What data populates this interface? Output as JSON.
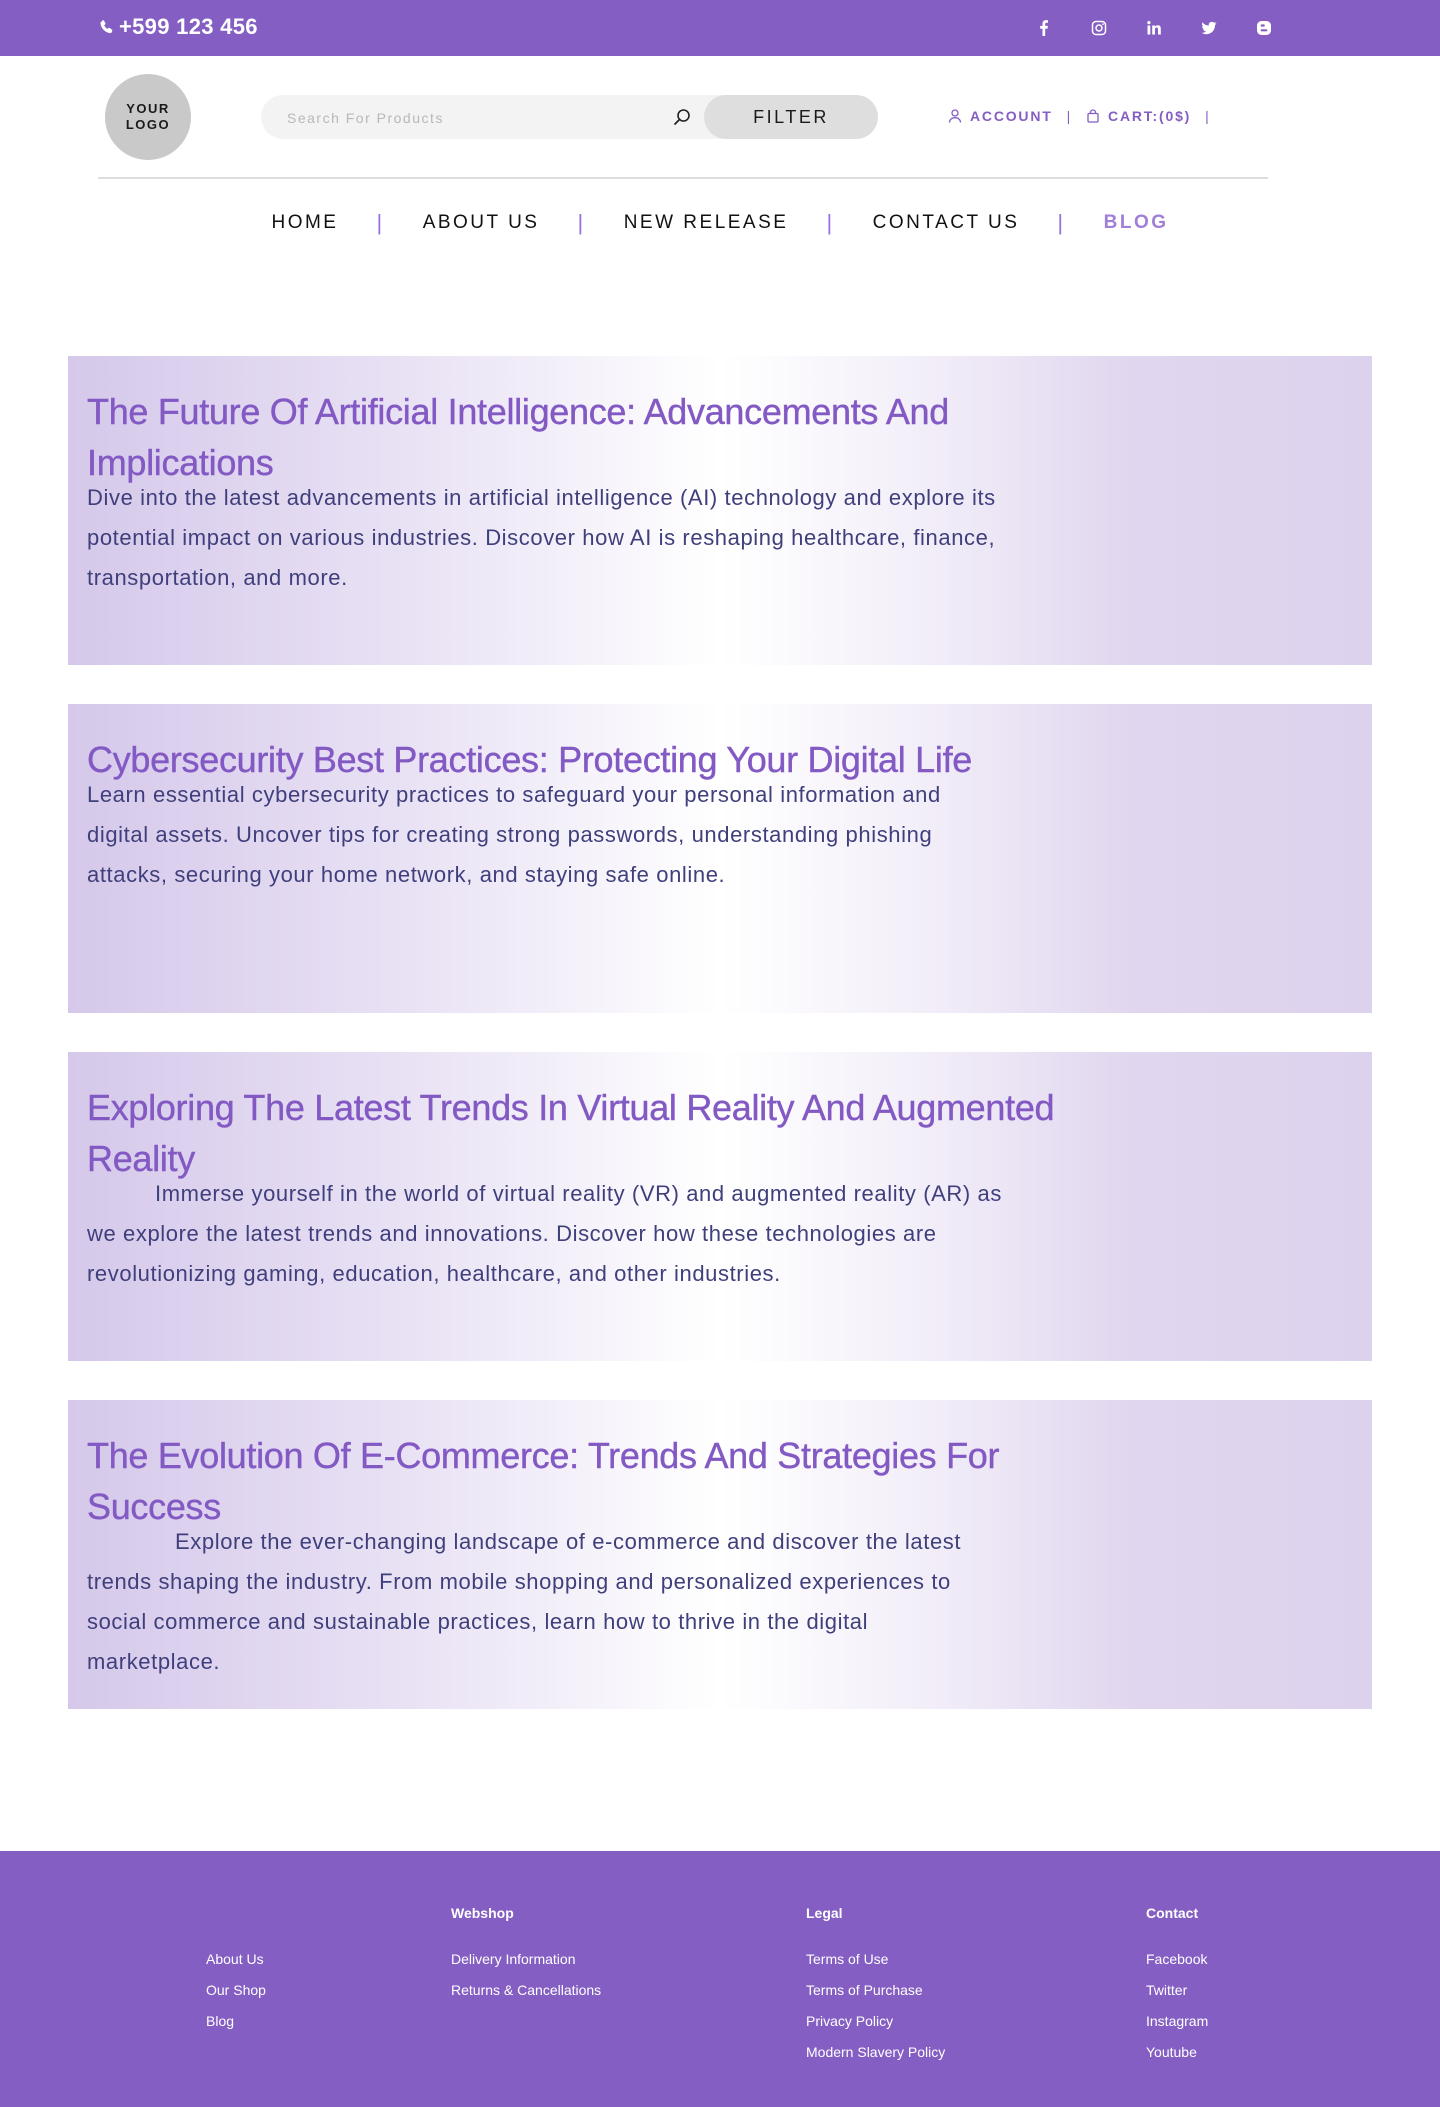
{
  "topbar": {
    "phone": "+599 123 456",
    "social_icons": [
      "facebook-icon",
      "instagram-icon",
      "linkedin-icon",
      "twitter-icon",
      "blogger-icon"
    ]
  },
  "header": {
    "logo_line1": "YOUR",
    "logo_line2": "LOGO",
    "search_placeholder": "Search For Products",
    "filter_label": "FILTER",
    "account_label": "ACCOUNT",
    "cart_label": "CART:(0$)"
  },
  "nav": {
    "items": [
      {
        "label": "HOME"
      },
      {
        "label": "ABOUT US"
      },
      {
        "label": "NEW RELEASE"
      },
      {
        "label": "CONTACT US"
      },
      {
        "label": "BLOG"
      }
    ]
  },
  "posts": [
    {
      "title": "The Future Of Artificial Intelligence: Advancements And Implications",
      "body": "Dive into the latest advancements in artificial intelligence (AI) technology and explore its potential impact on various industries. Discover how AI is reshaping healthcare, finance, transportation, and more."
    },
    {
      "title": "Cybersecurity Best Practices: Protecting Your Digital Life",
      "body": "Learn essential cybersecurity practices to safeguard your personal information and digital assets. Uncover tips for creating strong passwords, understanding phishing attacks, securing your home network, and staying safe online."
    },
    {
      "title": "Exploring The Latest Trends In Virtual Reality And Augmented Reality",
      "body": "Immerse yourself in the world of virtual reality (VR) and augmented reality (AR) as we explore the latest trends and innovations. Discover how these technologies are revolutionizing gaming, education, healthcare, and other industries."
    },
    {
      "title": "The Evolution Of E-Commerce: Trends And Strategies For Success",
      "body": "Explore the ever-changing landscape of e-commerce and discover the latest trends shaping the industry. From mobile shopping and personalized experiences to social commerce and sustainable practices, learn how to thrive in the digital marketplace."
    }
  ],
  "footer": {
    "col1": {
      "links": [
        "About Us",
        "Our Shop",
        "Blog"
      ]
    },
    "col2": {
      "heading": "Webshop",
      "links": [
        "Delivery Information",
        "Returns & Cancellations"
      ]
    },
    "col3": {
      "heading": "Legal",
      "links": [
        "Terms of Use",
        "Terms of Purchase",
        "Privacy Policy",
        "Modern Slavery Policy"
      ]
    },
    "col4": {
      "heading": "Contact",
      "links": [
        "Facebook",
        "Twitter",
        "Instagram",
        "Youtube"
      ]
    }
  },
  "colors": {
    "brand_purple": "#845ec2",
    "heading_purple": "#8359c3",
    "body_text": "#3f3f7c",
    "active_nav": "#a07fd8"
  }
}
